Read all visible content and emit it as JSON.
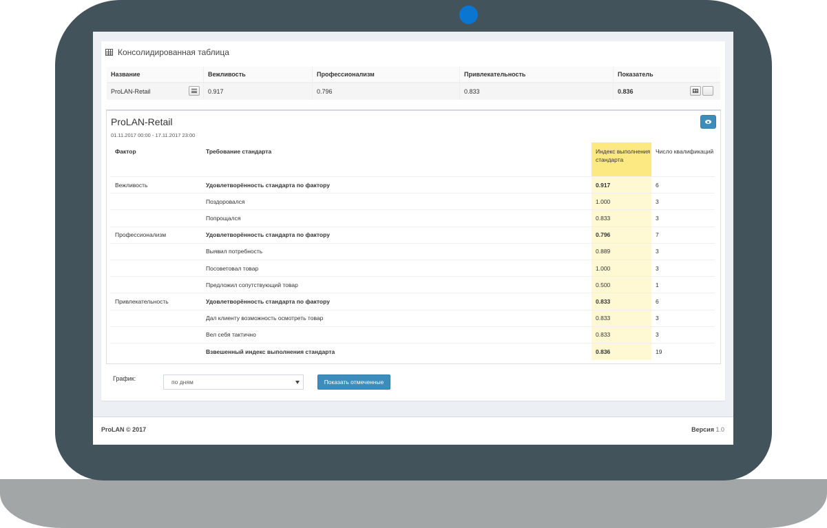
{
  "panel": {
    "title": "Консолидированная таблица"
  },
  "summary": {
    "headers": [
      "Название",
      "Вежливость",
      "Профессионализм",
      "Привлекательность",
      "Показатель"
    ],
    "row": {
      "name": "ProLAN-Retail",
      "politeness": "0.917",
      "professionalism": "0.796",
      "attractiveness": "0.833",
      "indicator": "0.836"
    }
  },
  "detail": {
    "title": "ProLAN-Retail",
    "date_range": "01.11.2017 00:00 - 17.11.2017 23:00",
    "headers": {
      "factor": "Фактор",
      "requirement": "Требование стандарта",
      "index": "Индекс выполнения стандарта",
      "count": "Число квалификаций"
    },
    "rows": [
      {
        "factor": "Вежливость",
        "requirement": "Удовлетворённость стандарта по фактору",
        "index": "0.917",
        "count": "6"
      },
      {
        "factor": "",
        "requirement": "Поздоровался",
        "index": "1.000",
        "count": "3"
      },
      {
        "factor": "",
        "requirement": "Попрощался",
        "index": "0.833",
        "count": "3"
      },
      {
        "factor": "Профессионализм",
        "requirement": "Удовлетворённость стандарта по фактору",
        "index": "0.796",
        "count": "7"
      },
      {
        "factor": "",
        "requirement": "Выявил потребность",
        "index": "0.889",
        "count": "3"
      },
      {
        "factor": "",
        "requirement": "Посоветовал товар",
        "index": "1.000",
        "count": "3"
      },
      {
        "factor": "",
        "requirement": "Предложил сопутствующий товар",
        "index": "0.500",
        "count": "1"
      },
      {
        "factor": "Привлекательность",
        "requirement": "Удовлетворённость стандарта по фактору",
        "index": "0.833",
        "count": "6"
      },
      {
        "factor": "",
        "requirement": "Дал клиенту возможность осмотреть товар",
        "index": "0.833",
        "count": "3"
      },
      {
        "factor": "",
        "requirement": "Вел себя тактично",
        "index": "0.833",
        "count": "3"
      },
      {
        "factor": "",
        "requirement": "Взвешенный индекс выполнения стандарта",
        "index": "0.836",
        "count": "19"
      }
    ]
  },
  "controls": {
    "chart_label": "График:",
    "select_value": "по дням",
    "show_cancelled": "Показать отмеченные"
  },
  "footer": {
    "copyright": "ProLAN © 2017",
    "version_label": "Версия",
    "version": "1.0"
  },
  "icons": {
    "panel": "table-icon",
    "row_menu": "menu-icon",
    "row_table": "table-icon",
    "detail_view": "eye-icon"
  },
  "colors": {
    "primary": "#3c8dbc",
    "index_header": "#fde982",
    "index_cell": "#fef9d3",
    "frame": "#43535c",
    "camera": "#0b76d2",
    "base": "#a3a6a6"
  }
}
